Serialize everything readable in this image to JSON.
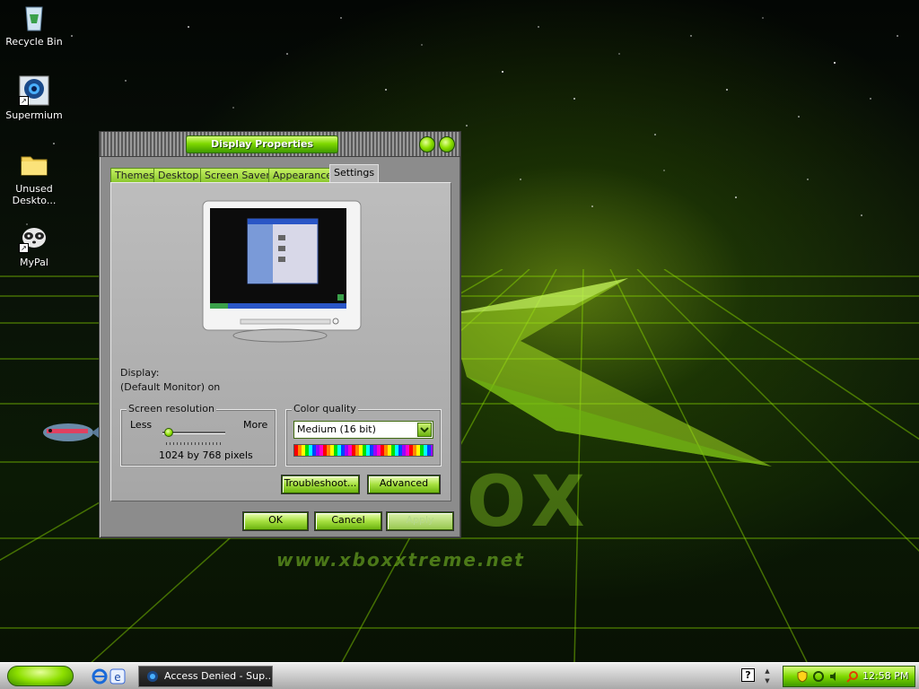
{
  "desktop": {
    "icons": [
      {
        "label": "Recycle Bin",
        "icon": "recycle-bin-icon"
      },
      {
        "label": "Supermium",
        "icon": "supermium-browser-icon"
      },
      {
        "label": "Unused Deskto...",
        "icon": "folder-icon"
      },
      {
        "label": "MyPal",
        "icon": "mypal-browser-icon"
      }
    ],
    "wallpaper_text": "www.xboxxtreme.net",
    "wallpaper_logo_text": "OX",
    "accent_color": "#8ee000"
  },
  "dialog": {
    "title": "Display Properties",
    "tabs": [
      {
        "label": "Themes",
        "active": false
      },
      {
        "label": "Desktop",
        "active": false
      },
      {
        "label": "Screen Saver",
        "active": false
      },
      {
        "label": "Appearance",
        "active": false
      },
      {
        "label": "Settings",
        "active": true
      }
    ],
    "display_label": "Display:",
    "display_value": "(Default Monitor) on",
    "screen_resolution": {
      "group_title": "Screen resolution",
      "less_label": "Less",
      "more_label": "More",
      "value_text": "1024 by 768 pixels",
      "slider_level": 0.1
    },
    "color_quality": {
      "group_title": "Color quality",
      "selected": "Medium (16 bit)"
    },
    "buttons": {
      "troubleshoot": "Troubleshoot...",
      "advanced": "Advanced",
      "ok": "OK",
      "cancel": "Cancel",
      "apply": "Apply"
    }
  },
  "taskbar": {
    "task_label": "Access Denied - Sup...",
    "clock": "12:58 PM",
    "help_glyph": "?"
  }
}
